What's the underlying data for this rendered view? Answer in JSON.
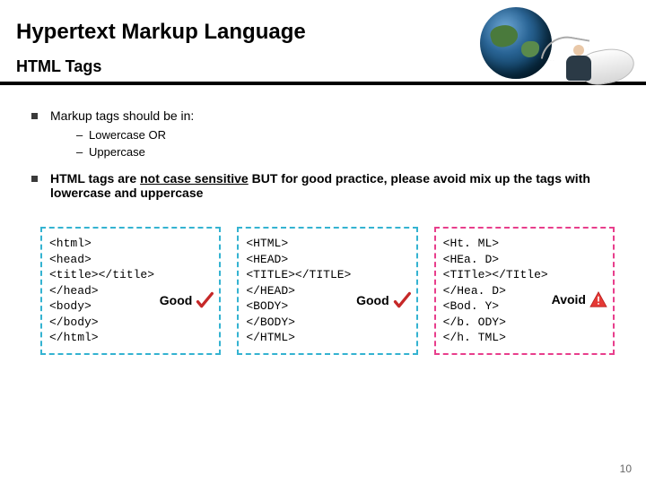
{
  "title": "Hypertext Markup Language",
  "subtitle": "HTML Tags",
  "bullets": {
    "b1": "Markup tags should be in:",
    "sub1": "Lowercase OR",
    "sub2": "Uppercase",
    "b2_prefix": "HTML tags are ",
    "b2_not": "not case sensitive",
    "b2_suffix": " BUT for good practice, please avoid mix up the tags with lowercase and uppercase"
  },
  "box1": {
    "lines": [
      "<html>",
      "<head>",
      "<title></title>",
      "</head>",
      "<body>",
      "</body>",
      "</html>"
    ],
    "badge": "Good"
  },
  "box2": {
    "lines": [
      "<HTML>",
      "<HEAD>",
      "<TITLE></TITLE>",
      "</HEAD>",
      "<BODY>",
      "</BODY>",
      "</HTML>"
    ],
    "badge": "Good"
  },
  "box3": {
    "lines": [
      "<Ht. ML>",
      "<HEa. D>",
      "<TITle></TItle>",
      "</Hea. D>",
      "<Bod. Y>",
      "</b. ODY>",
      "</h. TML>"
    ],
    "badge": "Avoid"
  },
  "page_number": "10"
}
